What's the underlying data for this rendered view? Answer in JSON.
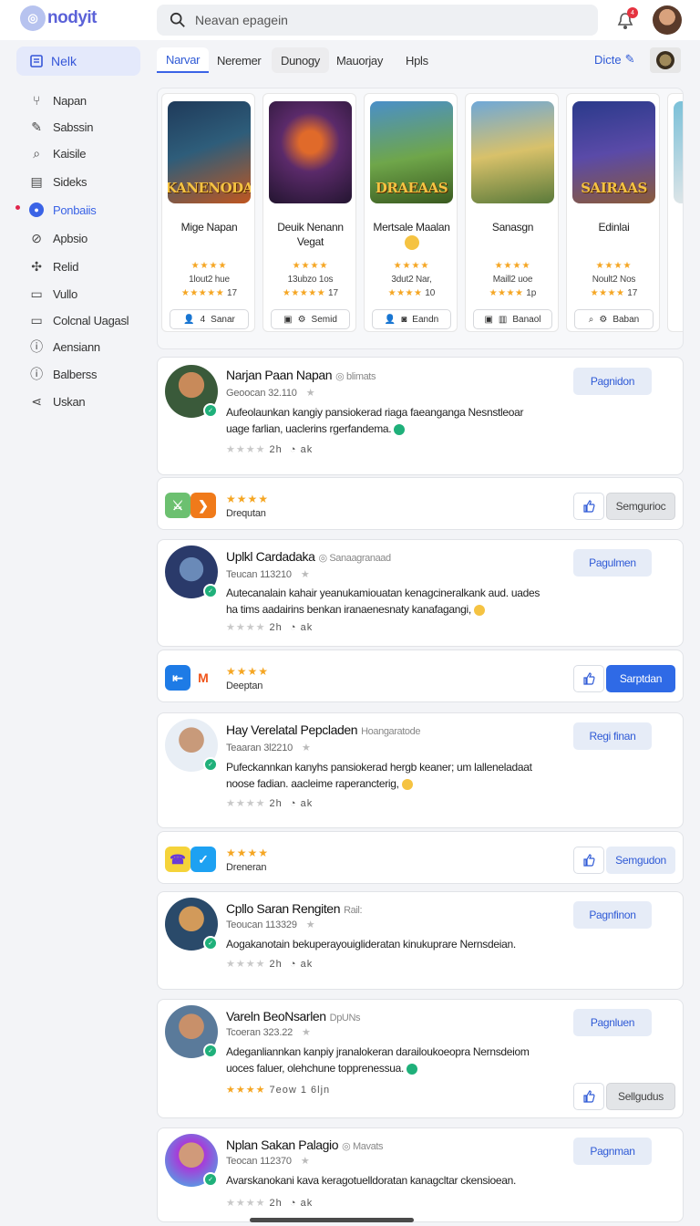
{
  "app": {
    "logo_mark": "◎",
    "logo_text": "nodyit"
  },
  "search": {
    "placeholder": "Neavan epagein"
  },
  "notifications": {
    "badge": "4"
  },
  "sidebar": {
    "active": "Nelk",
    "items": [
      {
        "label": "Napan",
        "icon": "tuning-fork-icon"
      },
      {
        "label": "Sabssin",
        "icon": "brush-icon"
      },
      {
        "label": "Kaisile",
        "icon": "search-icon"
      },
      {
        "label": "Sideks",
        "icon": "document-icon"
      },
      {
        "label": "Ponbaiis",
        "icon": "circle-icon"
      },
      {
        "label": "Apbsio",
        "icon": "link-icon"
      },
      {
        "label": "Relid",
        "icon": "puzzle-icon"
      },
      {
        "label": "Vullo",
        "icon": "wallet-icon"
      },
      {
        "label": "Colcnal Uagasl",
        "icon": "card-icon"
      },
      {
        "label": "Aensiann",
        "icon": "info-icon"
      },
      {
        "label": "Balberss",
        "icon": "info-icon"
      },
      {
        "label": "Uskan",
        "icon": "share-icon"
      }
    ]
  },
  "tabs": [
    {
      "label": "Narvar"
    },
    {
      "label": "Neremer"
    },
    {
      "label": "Dunogy"
    },
    {
      "label": "Mauorjay"
    },
    {
      "label": "Hpls"
    }
  ],
  "tab_link": "Dicte",
  "games": [
    {
      "art_text": "KANENODA",
      "name": "Mige Napan",
      "name2": "",
      "stars": "★★★★",
      "meta": "1lout2 hue",
      "meta2_stars": "★★★★★",
      "meta2": "17",
      "btn_num": "4",
      "btn": "Sanar"
    },
    {
      "art_text": "",
      "name": "Deuik Nenann",
      "name2": "Vegat",
      "stars": "★★★★",
      "meta": "13ubzo 1os",
      "meta2_stars": "★★★★★",
      "meta2": "17",
      "btn_num": "",
      "btn": "Semid"
    },
    {
      "art_text": "DRAEAAS",
      "name": "Mertsale Maalan",
      "name2": "",
      "stars": "★★★★",
      "meta": "3dut2 Nar,",
      "meta2_stars": "★★★★",
      "meta2": "10",
      "btn_num": "",
      "btn": "Eandn"
    },
    {
      "art_text": "",
      "name": "Sanasgn",
      "name2": "",
      "stars": "★★★★",
      "meta": "Maill2 uoe",
      "meta2_stars": "★★★★",
      "meta2": "1p",
      "btn_num": "",
      "btn": "Banaol"
    },
    {
      "art_text": "SAIRAAS",
      "name": "Edinlai",
      "name2": "",
      "stars": "★★★★",
      "meta": "Noult2 Nos",
      "meta2_stars": "★★★★",
      "meta2": "17",
      "btn_num": "",
      "btn": "Baban"
    }
  ],
  "reviews": [
    {
      "name": "Narjan Paan Napan",
      "tag": "◎ blimats",
      "date": "Geoocan 32.110",
      "text": "Aufeolaunkan kangiy pansiokerad riaga faeanganga Nesnstleoar uage farlian, uaclerins rgerfandema.",
      "foot": "2h",
      "foot_stars_yellow": false,
      "btn": "Pagnidon"
    },
    {
      "name": "Uplkl Cardadaka",
      "tag": "◎ Sanaagranaad",
      "date": "Teucan 113210",
      "text": "Autecanalain kahair yeanukamiouatan kenagcineralkank aud. uades ha tims aadairins benkan iranaenesnaty kanafagangi,",
      "foot": "2h",
      "foot_stars_yellow": false,
      "btn": "Pagulmen"
    },
    {
      "name": "Hay Verelatal Pepcladen",
      "tag": "Hoangaratode",
      "date": "Teaaran 3l2210",
      "text": "Pufeckannkan kanyhs pansiokerad hergb keaner; um lalleneladaat noose fadian. aacleime raperancterig,",
      "foot": "2h",
      "foot_stars_yellow": false,
      "btn": "Regi finan"
    },
    {
      "name": "Cpllo Saran Rengiten",
      "tag": "Rail:",
      "date": "Teoucan 113329",
      "text": "Aogakanotain bekuperayouiglideratan kinukuprare Nernsdeian.",
      "foot": "2h",
      "foot_stars_yellow": false,
      "btn": "Pagnfinon"
    },
    {
      "name": "Vareln BeoNsarlen",
      "tag": "DpUNs",
      "date": "Tcoeran 323.22",
      "text": "Adeganliannkan kanpiy jranalokeran darailoukoeopra Nernsdeiom uoces faluer, olehchune topprenessua.",
      "foot": "7eow 1 6ljn",
      "foot_stars_yellow": true,
      "btn": "Pagnluen"
    },
    {
      "name": "Nplan Sakan Palagio",
      "tag": "◎ Mavats",
      "date": "Teocan 112370",
      "text": "Avarskanokani kava keragotuelldoratan kanagcltar ckensioean.",
      "foot": "2h",
      "foot_stars_yellow": false,
      "btn": "Pagnman"
    }
  ],
  "mini_cards": [
    {
      "stars": "★★★★",
      "label": "Drequtan",
      "follow": "Semgurioc"
    },
    {
      "stars": "★★★★",
      "label": "Deeptan",
      "follow": "Sarptdan"
    },
    {
      "stars": "★★★★",
      "label": "Dreneran",
      "follow": "Semgudon"
    }
  ],
  "review5_follow": "Sellgudus",
  "ai_label": "ak",
  "colors": {
    "accent": "#3a63e6",
    "star": "#f5a623",
    "brand": "#5b62d8"
  }
}
